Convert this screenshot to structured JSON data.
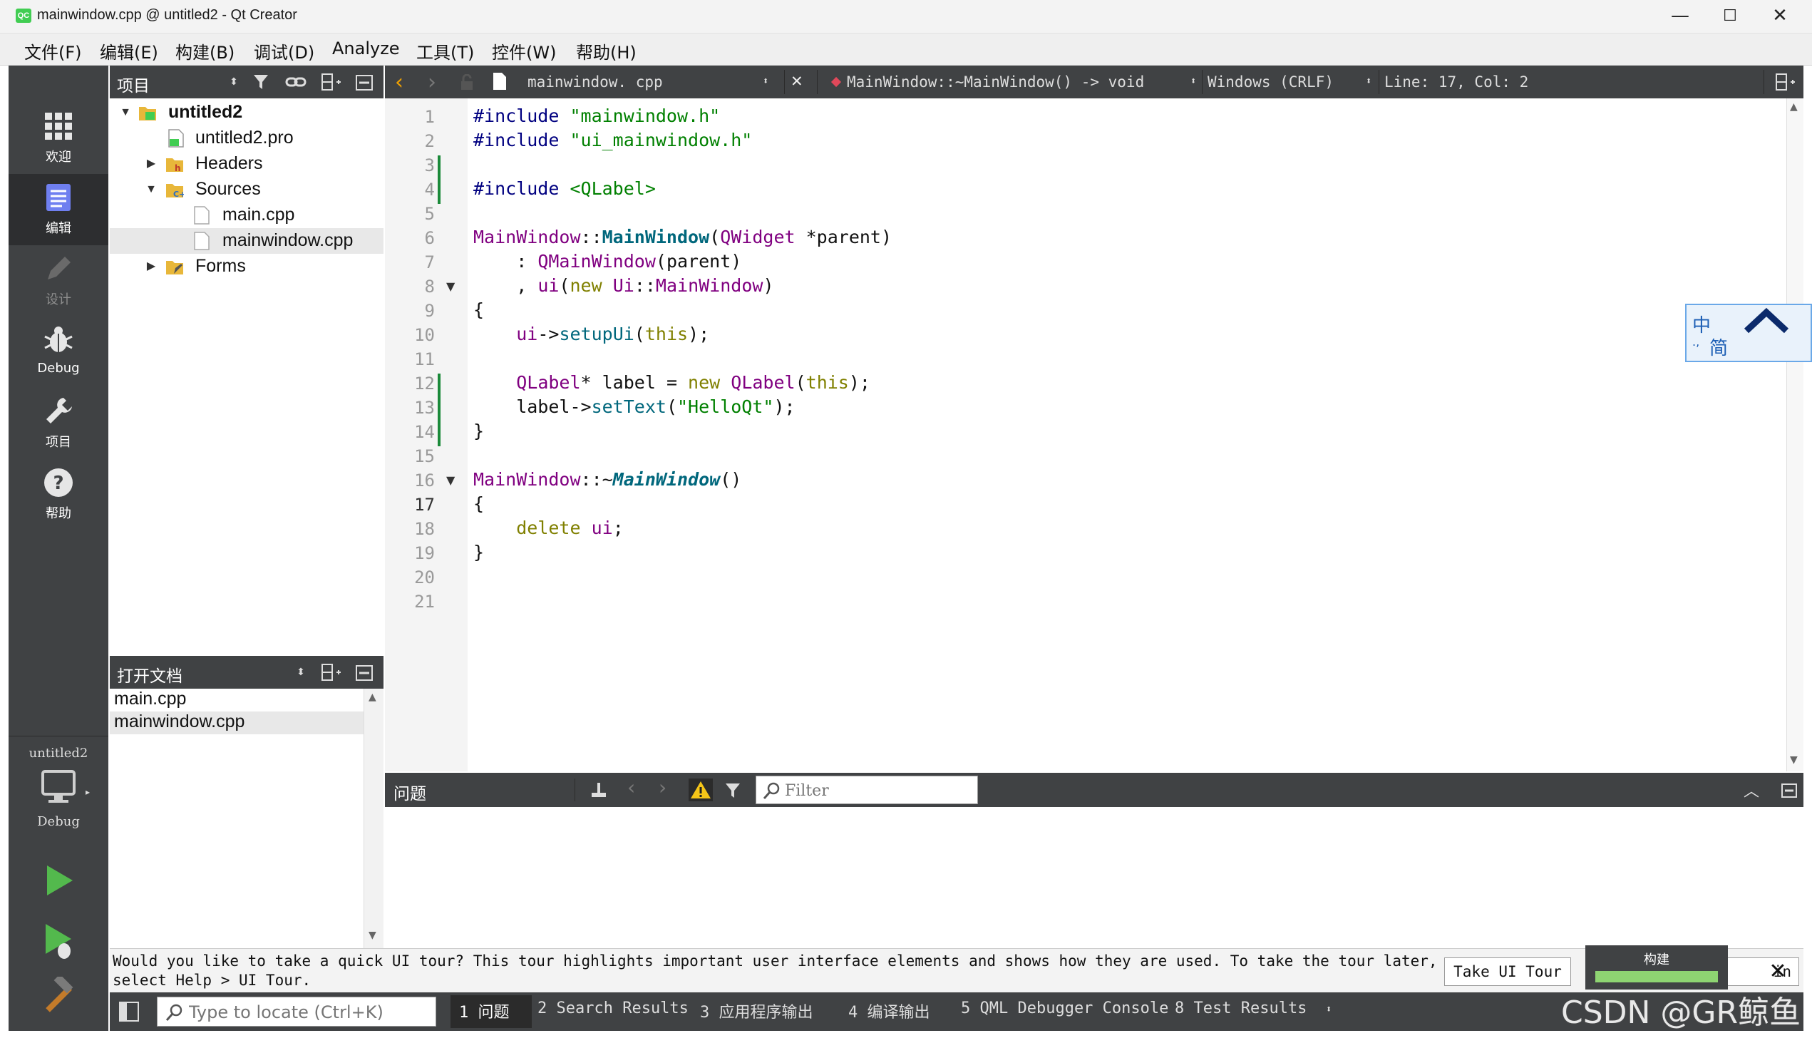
{
  "window": {
    "title": "mainwindow.cpp @ untitled2 - Qt Creator",
    "icon_text": "QC",
    "minimize_glyph": "—",
    "maximize_glyph": "☐",
    "close_glyph": "✕"
  },
  "menubar": {
    "items": [
      "文件(F)",
      "编辑(E)",
      "构建(B)",
      "调试(D)",
      "Analyze",
      "工具(T)",
      "控件(W)",
      "帮助(H)"
    ]
  },
  "modes": {
    "items": [
      {
        "label": "欢迎",
        "icon": "grid-icon",
        "state": "normal"
      },
      {
        "label": "编辑",
        "icon": "document-icon",
        "state": "active"
      },
      {
        "label": "设计",
        "icon": "pencil-icon",
        "state": "dim"
      },
      {
        "label": "Debug",
        "icon": "bug-icon",
        "state": "normal"
      },
      {
        "label": "项目",
        "icon": "wrench-icon",
        "state": "normal"
      },
      {
        "label": "帮助",
        "icon": "help-icon",
        "state": "normal"
      }
    ],
    "kit_project": "untitled2",
    "kit_config": "Debug"
  },
  "project_panel": {
    "title": "项目",
    "tree": [
      {
        "label": "untitled2",
        "level": 0,
        "expanded": true,
        "icon": "project-folder-icon",
        "bold": true
      },
      {
        "label": "untitled2.pro",
        "level": 1,
        "icon": "pro-file-icon"
      },
      {
        "label": "Headers",
        "level": 1,
        "expanded": false,
        "icon": "headers-folder-icon"
      },
      {
        "label": "Sources",
        "level": 1,
        "expanded": true,
        "icon": "sources-folder-icon"
      },
      {
        "label": "main.cpp",
        "level": 2,
        "icon": "cpp-file-icon"
      },
      {
        "label": "mainwindow.cpp",
        "level": 2,
        "icon": "cpp-file-icon",
        "selected": true
      },
      {
        "label": "Forms",
        "level": 1,
        "expanded": false,
        "icon": "forms-folder-icon"
      }
    ]
  },
  "open_docs": {
    "title": "打开文档",
    "items": [
      {
        "label": "main.cpp"
      },
      {
        "label": "mainwindow.cpp",
        "selected": true
      }
    ]
  },
  "editor_toolbar": {
    "file_name": "mainwindow. cpp",
    "symbol": "MainWindow::~MainWindow() -> void",
    "line_ending": "Windows (CRLF)",
    "position": "Line: 17, Col: 2"
  },
  "editor": {
    "line_numbers": [
      "1",
      "2",
      "3",
      "4",
      "5",
      "6",
      "7",
      "8",
      "9",
      "10",
      "11",
      "12",
      "13",
      "14",
      "15",
      "16",
      "17",
      "18",
      "19",
      "20",
      "21"
    ],
    "current_line": 17
  },
  "issues_pane": {
    "title": "问题",
    "filter_placeholder": "Filter"
  },
  "tour_bar": {
    "message": "Would you like to take a quick UI tour? This tour highlights important user interface elements and shows how they are used. To take the tour later, select Help > UI Tour.",
    "take_tour_label": "Take UI Tour",
    "second_button_tail": "in",
    "close_glyph": "✕"
  },
  "build": {
    "label": "构建",
    "progress": 1.0,
    "bar_color": "#8ed472"
  },
  "statusbar": {
    "locate_placeholder": "Type to locate (Ctrl+K)",
    "tabs": [
      {
        "label": "1  问题",
        "active": true
      },
      {
        "label": "2  Search Results"
      },
      {
        "label": "3  应用程序输出"
      },
      {
        "label": "4  编译输出"
      },
      {
        "label": "5  QML Debugger Console"
      },
      {
        "label": "8  Test Results"
      }
    ]
  },
  "ime": {
    "mode_char": "中",
    "script_char": "简",
    "punct_char": ".,"
  },
  "watermark": "CSDN @GR鲸鱼",
  "colors": {
    "sidebar": "#404244",
    "keyword": "#808000",
    "string": "#008000",
    "type": "#800080",
    "function": "#00677c",
    "preprocessor": "#000080",
    "change_marker": "#1b8a3a"
  }
}
